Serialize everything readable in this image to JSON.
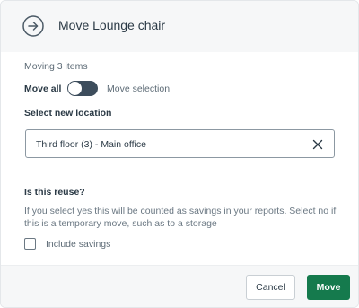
{
  "header": {
    "title": "Move Lounge chair",
    "icon": "arrow-right-circle-icon"
  },
  "form": {
    "moving_count": "Moving 3 items",
    "move_all_label": "Move all",
    "move_selection_label": "Move selection",
    "toggle_state": "move-all",
    "select_location_label": "Select new location",
    "location_value": "Third floor (3) - Main office",
    "reuse_title": "Is this reuse?",
    "reuse_description": "If you select yes this will be counted as savings in your reports. Select no if this is a temporary move, such as to a storage",
    "include_savings_label": "Include savings",
    "include_savings_checked": false
  },
  "footer": {
    "cancel_label": "Cancel",
    "move_label": "Move"
  },
  "colors": {
    "primary": "#157a4d",
    "toggle": "#3d4d5c"
  }
}
